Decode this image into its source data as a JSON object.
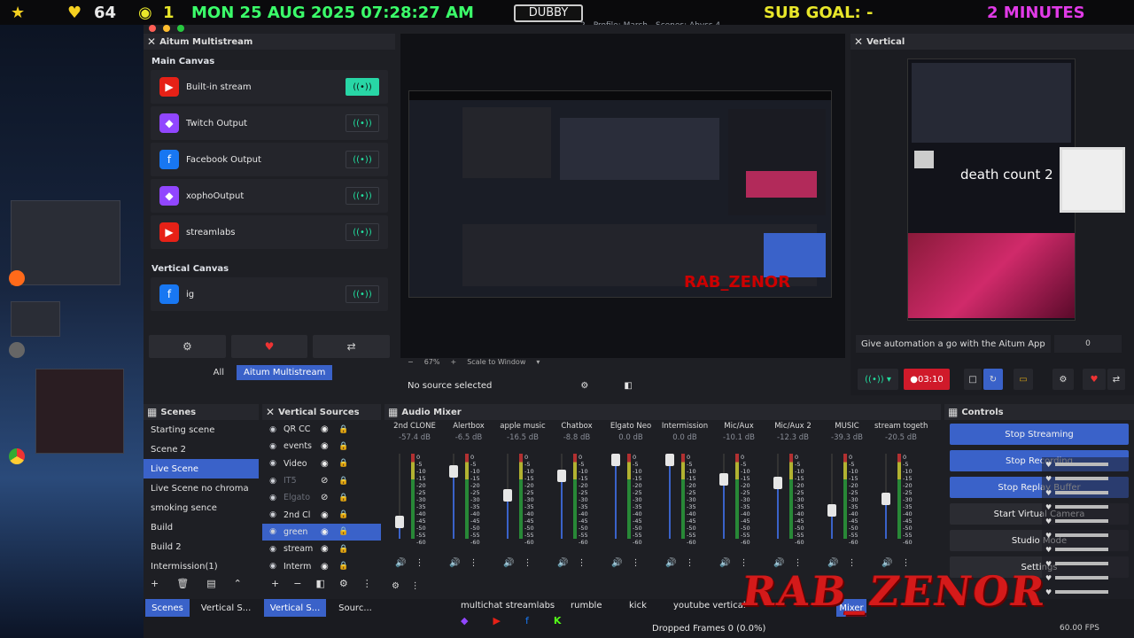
{
  "topbar": {
    "star_count": "",
    "hearts": "64",
    "coins": "1",
    "datetime": "MON 25 AUG 2025 07:28:27 AM",
    "logo_text": "DUBBY",
    "sub_goal": "SUB GOAL: -",
    "timer": "2 MINUTES",
    "window_title": "2 - Profile: March - Scenes: Abyss 4"
  },
  "multistream": {
    "title": "Aitum Multistream",
    "main_canvas_label": "Main Canvas",
    "outputs": [
      {
        "name": "Built-in stream",
        "icon": "youtube-icon",
        "color": "#e62117",
        "active": true
      },
      {
        "name": "Twitch Output",
        "icon": "twitch-icon",
        "color": "#9146ff",
        "active": false
      },
      {
        "name": "Facebook Output",
        "icon": "facebook-icon",
        "color": "#1877f2",
        "active": false
      },
      {
        "name": "xophoOutput",
        "icon": "twitch-icon",
        "color": "#9146ff",
        "active": false
      },
      {
        "name": "streamlabs",
        "icon": "youtube-icon",
        "color": "#e62117",
        "active": false
      }
    ],
    "vertical_canvas_label": "Vertical Canvas",
    "vertical_outputs": [
      {
        "name": "ig",
        "icon": "facebook-icon",
        "color": "#1877f2"
      }
    ],
    "tab_all": "All",
    "tab_aitum": "Aitum Multistream"
  },
  "preview": {
    "zoom": "67%",
    "scale_mode": "Scale to Window",
    "no_source": "No source selected"
  },
  "vertical": {
    "title": "Vertical",
    "death_count": "death count 2",
    "automation_text": "Give automation a go with the Aitum App",
    "automation_value": "0",
    "rec_time": "03:10"
  },
  "scenes": {
    "title": "Scenes",
    "items": [
      "Starting scene",
      "Scene 2",
      "Live Scene",
      "Live Scene no chroma",
      "smoking sence",
      "Build",
      "Build 2",
      "Intermission(1)"
    ],
    "selected": 2
  },
  "vsources": {
    "title": "Vertical Sources",
    "items": [
      {
        "name": "QR CC",
        "visible": true
      },
      {
        "name": "events",
        "visible": true
      },
      {
        "name": "Video",
        "visible": true
      },
      {
        "name": "IT5",
        "visible": false
      },
      {
        "name": "Elgato",
        "visible": false
      },
      {
        "name": "2nd Cl",
        "visible": true
      },
      {
        "name": "green",
        "visible": true,
        "selected": true
      },
      {
        "name": "stream",
        "visible": true
      },
      {
        "name": "Interm",
        "visible": true
      }
    ]
  },
  "mixer": {
    "title": "Audio Mixer",
    "channels": [
      {
        "name": "2nd CLONE",
        "db": "-57.4 dB",
        "level": 0.2
      },
      {
        "name": "Alertbox",
        "db": "-6.5 dB",
        "level": 0.85
      },
      {
        "name": "apple music",
        "db": "-16.5 dB",
        "level": 0.55
      },
      {
        "name": "Chatbox",
        "db": "-8.8 dB",
        "level": 0.8
      },
      {
        "name": "Elgato Neo",
        "db": "0.0 dB",
        "level": 1.0
      },
      {
        "name": "Intermission",
        "db": "0.0 dB",
        "level": 1.0
      },
      {
        "name": "Mic/Aux",
        "db": "-10.1 dB",
        "level": 0.75
      },
      {
        "name": "Mic/Aux 2",
        "db": "-12.3 dB",
        "level": 0.7
      },
      {
        "name": "MUSIC",
        "db": "-39.3 dB",
        "level": 0.35
      },
      {
        "name": "stream together",
        "db": "-20.5 dB",
        "level": 0.5
      }
    ],
    "scale": [
      "0",
      "-5",
      "-10",
      "-15",
      "-20",
      "-25",
      "-30",
      "-35",
      "-40",
      "-45",
      "-50",
      "-55",
      "-60"
    ]
  },
  "controls": {
    "title": "Controls",
    "buttons": [
      "Stop Streaming",
      "Stop Recording",
      "Stop Replay Buffer",
      "Start Virtual Camera",
      "Studio Mode",
      "Settings"
    ]
  },
  "bottom_tabs": {
    "scenes": "Scenes",
    "vertical_s": "Vertical S...",
    "vertical_s2": "Vertical S...",
    "sources": "Sourc...",
    "mixer_tab": "Mixer"
  },
  "platforms": {
    "multichat": "multichat streamlabs",
    "rumble": "rumble",
    "kick": "kick",
    "youtube_vertical": "youtube vertical"
  },
  "status": {
    "dropped": "Dropped Frames 0 (0.0%)",
    "fps": "60.00 FPS"
  },
  "overlay_text": "RAB_ZENOR"
}
